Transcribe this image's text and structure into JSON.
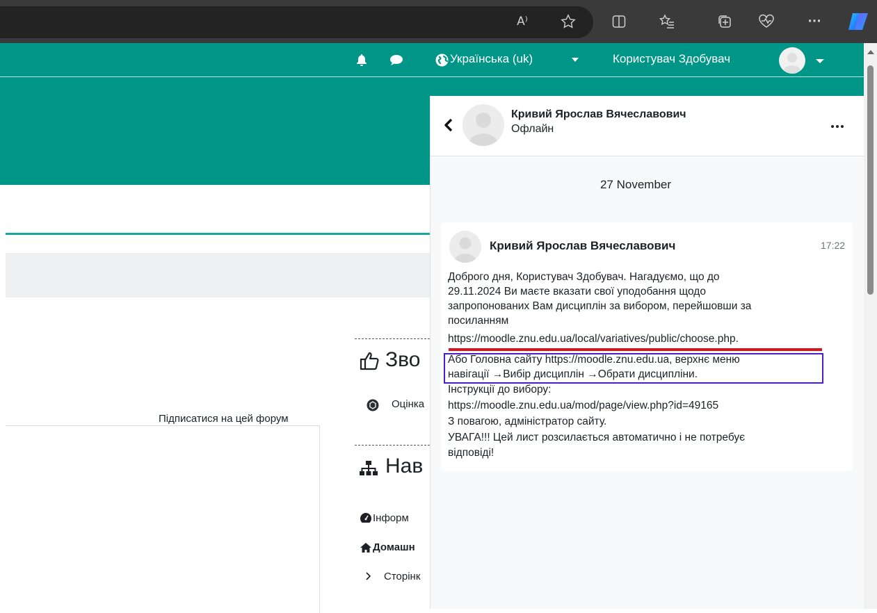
{
  "browser": {
    "icons": [
      "read-aloud-icon",
      "favorite-star-icon",
      "split-screen-icon",
      "favorites-icon",
      "collections-icon",
      "browser-essentials-icon",
      "more-icon",
      "copilot-icon"
    ],
    "read_aloud": "A⁾",
    "more": "···"
  },
  "navbar": {
    "language": "Українська (uk)",
    "user_name": "Користувач Здобувач"
  },
  "page": {
    "subscribe_link": "Підписатися на цей форум",
    "blocks": [
      {
        "title": "Зво",
        "icon": "thumbs-up-icon",
        "links": [
          "Оцінка"
        ]
      },
      {
        "title": "Нав",
        "icon": "sitemap-icon",
        "links": [
          "Інформ",
          "Домашн",
          "Сторінк"
        ]
      }
    ]
  },
  "drawer": {
    "contact_name": "Кривий Ярослав Вячеславович",
    "contact_status": "Офлайн",
    "date_separator": "27 November",
    "message": {
      "author": "Кривий Ярослав Вячеславович",
      "time": "17:22",
      "lines": [
        "Доброго дня, Користувач Здобувач. Нагадуємо, що до",
        "29.11.2024 Ви маєте вказати свої уподобання щодо",
        "запропонованих Вам дисциплін за вибором, перейшовши за",
        "посиланням",
        "https://moodle.znu.edu.ua/local/variatives/public/choose.php.",
        "Або Головна сайту https://moodle.znu.edu.ua, верхнє меню",
        "навігації →Вибір дисциплін →Обрати дисципліни.",
        "Інструкції до вибору:",
        "https://moodle.znu.edu.ua/mod/page/view.php?id=49165",
        "З повагою, адміністратор сайту.",
        "УВАГА!!! Цей лист розсилається автоматично і не потребує",
        "відповіді!"
      ]
    }
  },
  "colors": {
    "brand_teal": "#009687",
    "annotation_red": "#d9141f",
    "annotation_purple": "#4a1ec6"
  }
}
